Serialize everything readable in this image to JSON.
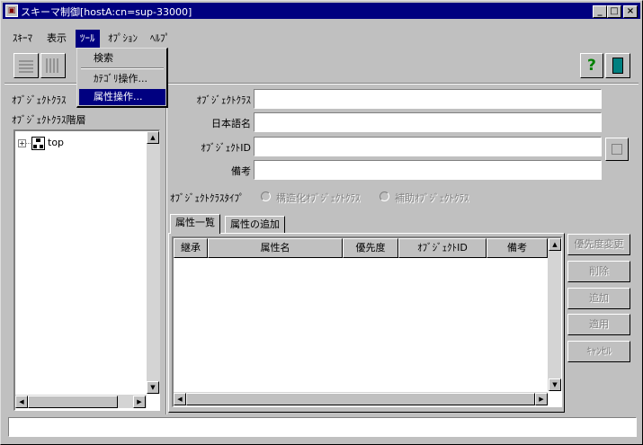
{
  "window": {
    "title": "スキーマ制御[hostA:cn=sup-33000]",
    "minimize": "_",
    "maximize": "□",
    "close": "×"
  },
  "menubar": {
    "items": [
      "ｽｷｰﾏ",
      "表示",
      "ﾂｰﾙ",
      "ｵﾌﾟｼｮﾝ",
      "ﾍﾙﾌﾟ"
    ],
    "active_index": 2
  },
  "tools_menu": {
    "items": [
      "検索",
      "ｶﾃｺﾞﾘ操作...",
      "属性操作..."
    ],
    "highlighted_index": 2
  },
  "toolbar": {
    "help_icon_glyph": "?",
    "icons": [
      "grid-icon",
      "delete-grid-icon",
      "help-icon",
      "exit-icon"
    ]
  },
  "left_panel": {
    "object_class_label": "ｵﾌﾞｼﾞｪｸﾄｸﾗｽ",
    "hierarchy_label": "ｵﾌﾞｼﾞｪｸﾄｸﾗｽ階層",
    "tree": {
      "expand_glyph": "+",
      "root_label": "top"
    }
  },
  "form": {
    "fields": [
      {
        "label": "ｵﾌﾞｼﾞｪｸﾄｸﾗｽ",
        "value": ""
      },
      {
        "label": "日本語名",
        "value": ""
      },
      {
        "label": "ｵﾌﾞｼﾞｪｸﾄID",
        "value": ""
      },
      {
        "label": "備考",
        "value": ""
      }
    ],
    "type_label": "ｵﾌﾞｼﾞｪｸﾄｸﾗｽﾀｲﾌﾟ",
    "type_options": [
      "構造化ｵﾌﾞｼﾞｪｸﾄｸﾗｽ",
      "補助ｵﾌﾞｼﾞｪｸﾄｸﾗｽ"
    ]
  },
  "tabs": [
    "属性一覧",
    "属性の追加"
  ],
  "active_tab": 0,
  "attribute_table": {
    "columns": [
      "継承",
      "属性名",
      "優先度",
      "ｵﾌﾞｼﾞｪｸﾄID",
      "備考"
    ],
    "rows": []
  },
  "side_buttons": [
    "優先度変更",
    "削除",
    "追加",
    "適用",
    "ｷｬﾝｾﾙ"
  ],
  "status_bar": {
    "text": ""
  },
  "scroll_glyphs": {
    "up": "▲",
    "down": "▼",
    "left": "◀",
    "right": "▶"
  }
}
